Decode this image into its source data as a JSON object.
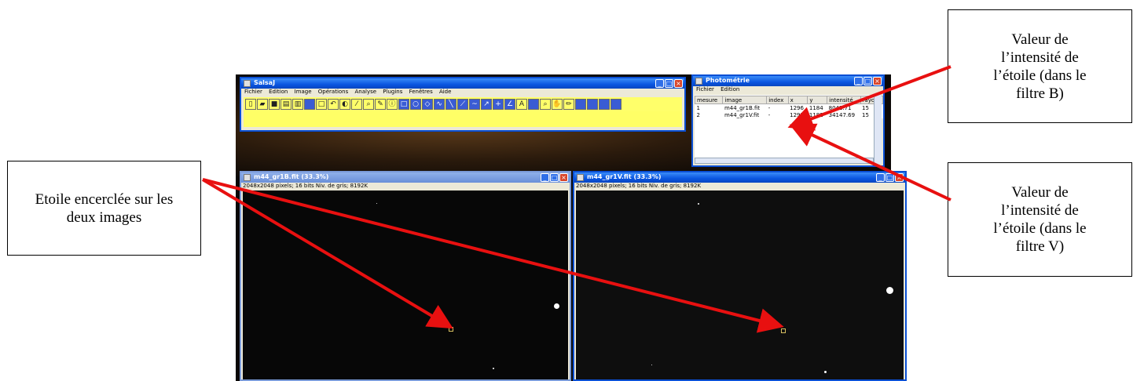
{
  "callouts": {
    "etoile": "Etoile encerclée sur les deux images",
    "valeur_b": "Valeur de l’intensité de l’étoile (dans le filtre B)",
    "valeur_v": "Valeur de l’intensité de l’étoile (dans le filtre V)"
  },
  "salsaj": {
    "title": "SalsaJ",
    "menu": [
      "Fichier",
      "Edition",
      "Image",
      "Opérations",
      "Analyse",
      "Plugins",
      "Fenêtres",
      "Aide"
    ]
  },
  "photometrie": {
    "title": "Photométrie",
    "menu": [
      "Fichier",
      "Edition"
    ],
    "headers": [
      "mesure",
      "image",
      "index",
      "x",
      "y",
      "intensité",
      "rayon"
    ],
    "rows": [
      [
        "1",
        "m44_gr1B.fit",
        "-",
        "1296",
        "1184",
        "8042.71",
        "15"
      ],
      [
        "2",
        "m44_gr1V.fit",
        "-",
        "1292",
        "1182",
        "34147.69",
        "15"
      ]
    ]
  },
  "image_b": {
    "title": "m44_gr1B.fit (33.3%)",
    "status": "2048x2048 pixels; 16 bits Niv. de gris; 8192K"
  },
  "image_v": {
    "title": "m44_gr1V.fit (33.3%)",
    "status": "2048x2048 pixels; 16 bits Niv. de gris; 8192K"
  },
  "colors": {
    "arrow": "#e81010",
    "titlebar": "#0a55e0",
    "toolbar": "#ffff6a"
  }
}
